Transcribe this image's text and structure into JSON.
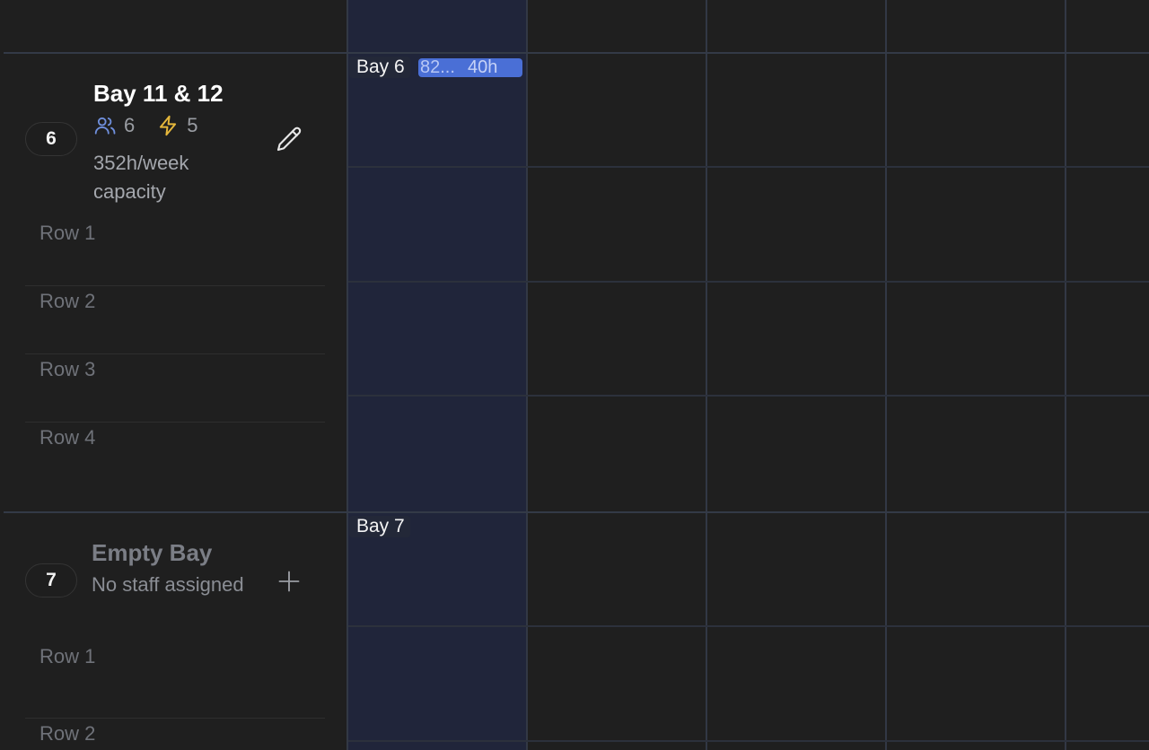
{
  "colors": {
    "background": "#1f1f1f",
    "today_column": "#20253a",
    "grid_line": "#323845",
    "event_chip": "#4a6fd6",
    "staff_icon": "#6f8fdc",
    "power_icon": "#e5b73b"
  },
  "bays": [
    {
      "number": "6",
      "title": "Bay 11 & 12",
      "staff_count": "6",
      "power_count": "5",
      "capacity": "352h/week capacity",
      "action_icon": "pencil-icon",
      "rows": [
        "Row 1",
        "Row 2",
        "Row 3",
        "Row 4"
      ],
      "timeline_label": "Bay 6",
      "event": {
        "id": "82...",
        "hours": "40h"
      }
    },
    {
      "number": "7",
      "title": "Empty Bay",
      "status": "No staff assigned",
      "action_icon": "plus-icon",
      "rows": [
        "Row 1",
        "Row 2"
      ],
      "timeline_label": "Bay 7"
    }
  ]
}
